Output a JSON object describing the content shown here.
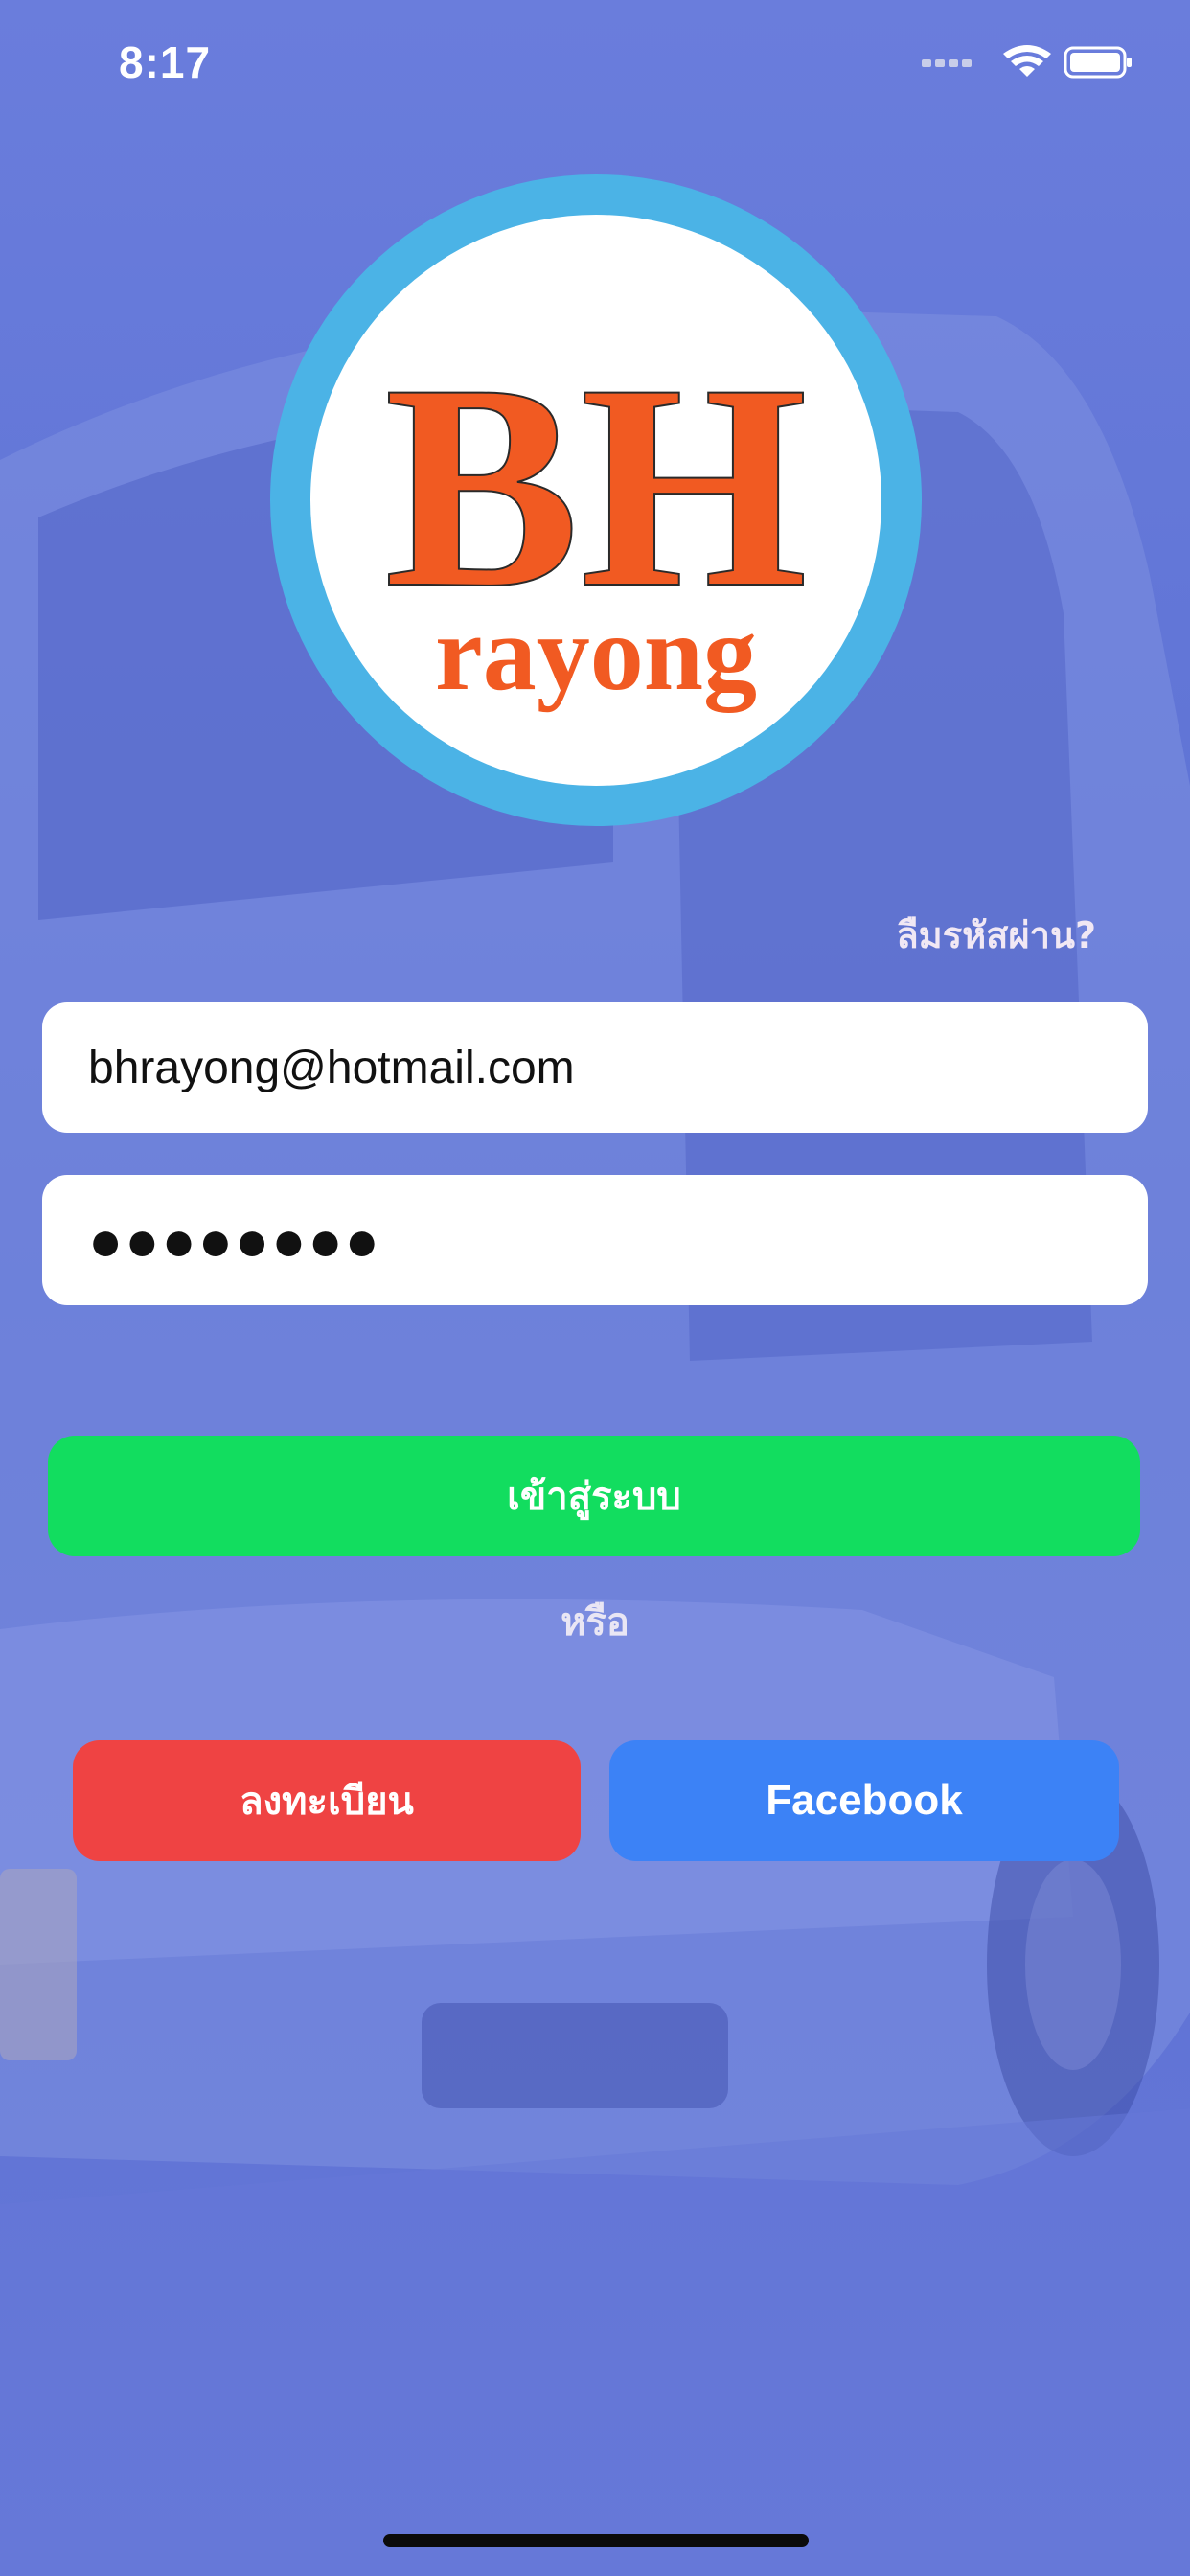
{
  "status_bar": {
    "time": "8:17",
    "icons": [
      "signal-icon",
      "wifi-icon",
      "battery-icon"
    ]
  },
  "logo": {
    "text_main": "BH",
    "text_sub": "rayong",
    "colors": {
      "ring": "#4bb3e6",
      "text": "#f15a22",
      "fill": "#ffffff"
    }
  },
  "forgot_password_label": "ลืมรหัสผ่าน?",
  "email": {
    "value": "bhrayong@hotmail.com"
  },
  "password": {
    "value": "●●●●●●●●"
  },
  "login_label": "เข้าสู่ระบบ",
  "or_label": "หรือ",
  "register_label": "ลงทะเบียน",
  "facebook_label": "Facebook",
  "colors": {
    "background": "#5f73d6",
    "login": "#12dd5f",
    "register": "#ef4343",
    "facebook": "#3c82f6"
  }
}
